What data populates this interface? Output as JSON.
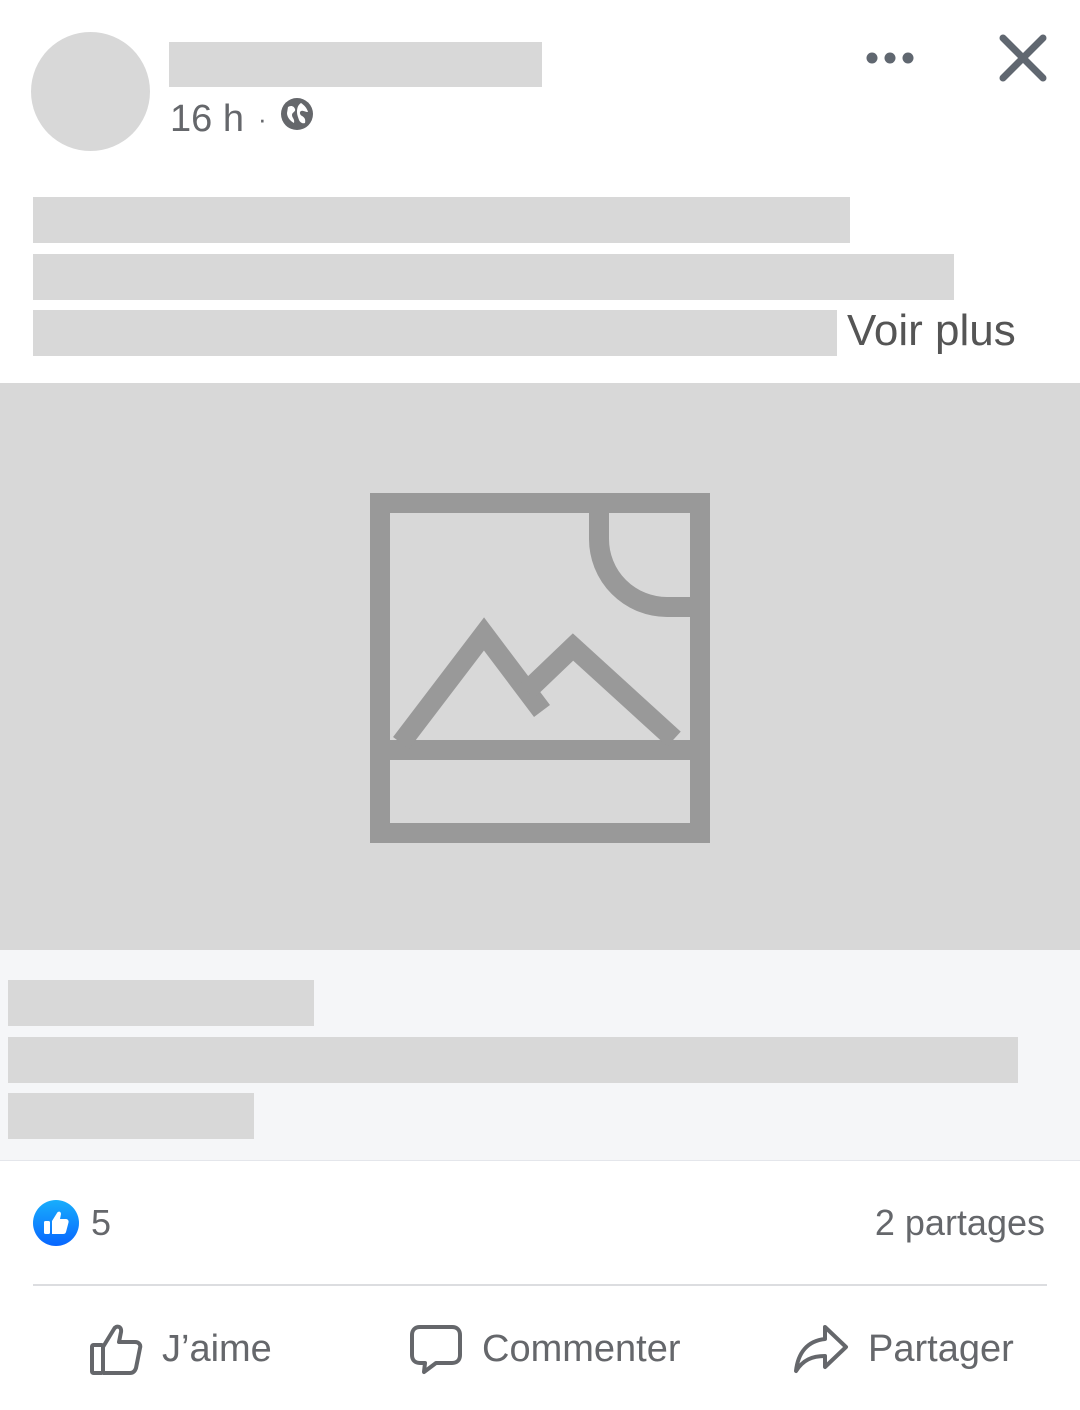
{
  "post": {
    "timestamp": "16 h",
    "separator": "·",
    "see_more": "Voir plus"
  },
  "stats": {
    "reaction_count": "5",
    "shares": "2 partages"
  },
  "actions": {
    "like": "J’aime",
    "comment": "Commenter",
    "share": "Partager"
  },
  "colors": {
    "placeholder": "#d8d8d8",
    "text_secondary": "#65676b",
    "like_blue": "#1877f2",
    "link_preview_bg": "#f5f6f8"
  },
  "icons": {
    "audience": "globe-icon",
    "more": "more-horizontal-icon",
    "close": "close-icon",
    "media": "image-placeholder-icon",
    "reaction": "like-reaction-icon",
    "like_action": "thumbs-up-icon",
    "comment_action": "comment-bubble-icon",
    "share_action": "share-arrow-icon"
  }
}
